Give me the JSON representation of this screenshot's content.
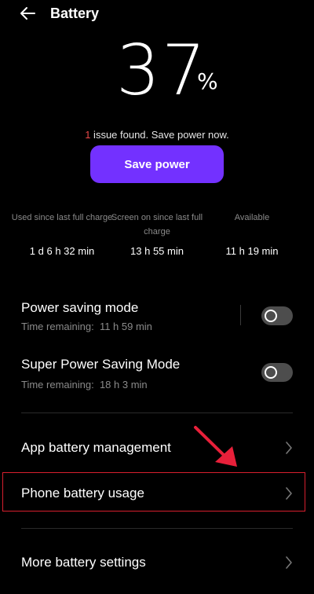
{
  "header": {
    "title": "Battery",
    "back_icon": "arrow-left-icon"
  },
  "battery": {
    "percent": "37",
    "percent_sign": "%"
  },
  "issue": {
    "count": "1",
    "text": " issue found. Save power now."
  },
  "save_button": {
    "label": "Save power",
    "color": "#7331ff"
  },
  "stats": [
    {
      "label": "Used since last full charge",
      "value": "1 d 6 h 32 min"
    },
    {
      "label": "Screen on since last full charge",
      "value": "13 h 55 min"
    },
    {
      "label": "Available",
      "value": "11 h 19 min"
    }
  ],
  "modes": [
    {
      "title": "Power saving mode",
      "subtitle": "Time remaining:  11 h 59 min",
      "enabled": false
    },
    {
      "title": "Super Power Saving Mode",
      "subtitle": "Time remaining:  18 h 3 min",
      "enabled": false
    }
  ],
  "menu": [
    {
      "label": "App battery management",
      "icon": "chevron-right-icon"
    },
    {
      "label": "Phone battery usage",
      "icon": "chevron-right-icon",
      "highlighted": true
    },
    {
      "label": "More battery settings",
      "icon": "chevron-right-icon"
    }
  ],
  "colors": {
    "background": "#000000",
    "accent": "#7331ff",
    "issue_red": "#e84848",
    "highlight_red": "#d71f2e",
    "arrow_red": "#e8203a"
  }
}
